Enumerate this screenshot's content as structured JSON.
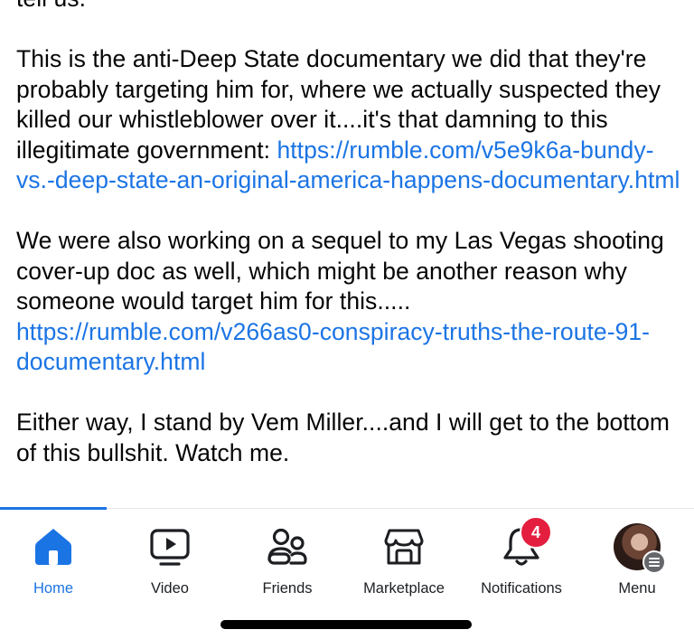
{
  "post": {
    "paragraphs": [
      {
        "text": "tell us.",
        "link": ""
      },
      {
        "text": "This is the anti-Deep State documentary we did that they're probably targeting him for, where we actually suspected they killed our whistleblower over it....it's that damning to this illegitimate government: ",
        "link": "https://rumble.com/v5e9k6a-bundy-vs.-deep-state-an-original-america-happens-documentary.html"
      },
      {
        "text": "We were also working on a sequel to my Las Vegas shooting cover-up doc as well, which might be another reason why someone would target him for this..... ",
        "link": "https://rumble.com/v266as0-conspiracy-truths-the-route-91-documentary.html"
      },
      {
        "text": "Either way, I stand by Vem Miller....and I will get to the bottom of this bullshit. Watch me.",
        "link": ""
      }
    ]
  },
  "tabbar": {
    "accent_color": "#1b74e4",
    "tabs": [
      {
        "label": "Home",
        "icon": "home-icon",
        "active": true
      },
      {
        "label": "Video",
        "icon": "video-icon",
        "active": false
      },
      {
        "label": "Friends",
        "icon": "friends-icon",
        "active": false
      },
      {
        "label": "Marketplace",
        "icon": "marketplace-icon",
        "active": false
      },
      {
        "label": "Notifications",
        "icon": "bell-icon",
        "active": false,
        "badge": "4"
      },
      {
        "label": "Menu",
        "icon": "avatar",
        "active": false
      }
    ]
  }
}
